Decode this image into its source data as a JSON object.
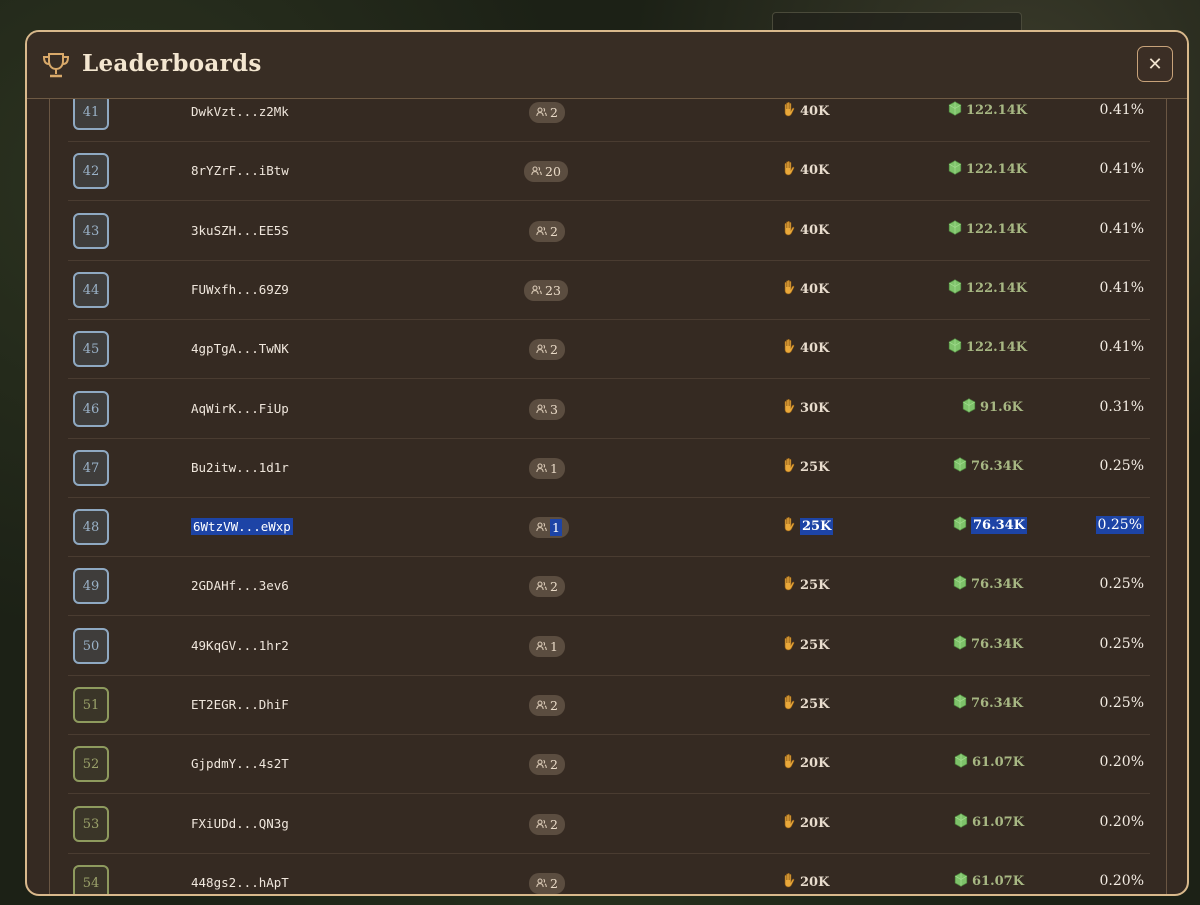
{
  "modal": {
    "title": "Leaderboards",
    "close_label": "✕"
  },
  "colors": {
    "accent_border": "#d9b98c",
    "rank_blue": "#8fa9c2",
    "rank_green": "#8e9a5e",
    "gem_green": "#7ec26a",
    "hand_orange": "#e9a83a",
    "selection": "#1d44a6"
  },
  "icons": {
    "title": "trophy-icon",
    "members": "people-icon",
    "score": "hand-icon",
    "reward": "gem-icon",
    "close": "close-icon"
  },
  "rows": [
    {
      "rank": "41",
      "address": "DwkVzt...z2Mk",
      "members": "2",
      "score": "40K",
      "reward": "122.14K",
      "share": "0.41%",
      "badge": "blue",
      "selected": false
    },
    {
      "rank": "42",
      "address": "8rYZrF...iBtw",
      "members": "20",
      "score": "40K",
      "reward": "122.14K",
      "share": "0.41%",
      "badge": "blue",
      "selected": false
    },
    {
      "rank": "43",
      "address": "3kuSZH...EE5S",
      "members": "2",
      "score": "40K",
      "reward": "122.14K",
      "share": "0.41%",
      "badge": "blue",
      "selected": false
    },
    {
      "rank": "44",
      "address": "FUWxfh...69Z9",
      "members": "23",
      "score": "40K",
      "reward": "122.14K",
      "share": "0.41%",
      "badge": "blue",
      "selected": false
    },
    {
      "rank": "45",
      "address": "4gpTgA...TwNK",
      "members": "2",
      "score": "40K",
      "reward": "122.14K",
      "share": "0.41%",
      "badge": "blue",
      "selected": false
    },
    {
      "rank": "46",
      "address": "AqWirK...FiUp",
      "members": "3",
      "score": "30K",
      "reward": "91.6K",
      "share": "0.31%",
      "badge": "blue",
      "selected": false
    },
    {
      "rank": "47",
      "address": "Bu2itw...1d1r",
      "members": "1",
      "score": "25K",
      "reward": "76.34K",
      "share": "0.25%",
      "badge": "blue",
      "selected": false
    },
    {
      "rank": "48",
      "address": "6WtzVW...eWxp",
      "members": "1",
      "score": "25K",
      "reward": "76.34K",
      "share": "0.25%",
      "badge": "blue",
      "selected": true
    },
    {
      "rank": "49",
      "address": "2GDAHf...3ev6",
      "members": "2",
      "score": "25K",
      "reward": "76.34K",
      "share": "0.25%",
      "badge": "blue",
      "selected": false
    },
    {
      "rank": "50",
      "address": "49KqGV...1hr2",
      "members": "1",
      "score": "25K",
      "reward": "76.34K",
      "share": "0.25%",
      "badge": "blue",
      "selected": false
    },
    {
      "rank": "51",
      "address": "ET2EGR...DhiF",
      "members": "2",
      "score": "25K",
      "reward": "76.34K",
      "share": "0.25%",
      "badge": "green",
      "selected": false
    },
    {
      "rank": "52",
      "address": "GjpdmY...4s2T",
      "members": "2",
      "score": "20K",
      "reward": "61.07K",
      "share": "0.20%",
      "badge": "green",
      "selected": false
    },
    {
      "rank": "53",
      "address": "FXiUDd...QN3g",
      "members": "2",
      "score": "20K",
      "reward": "61.07K",
      "share": "0.20%",
      "badge": "green",
      "selected": false
    },
    {
      "rank": "54",
      "address": "448gs2...hApT",
      "members": "2",
      "score": "20K",
      "reward": "61.07K",
      "share": "0.20%",
      "badge": "green",
      "selected": false
    }
  ]
}
